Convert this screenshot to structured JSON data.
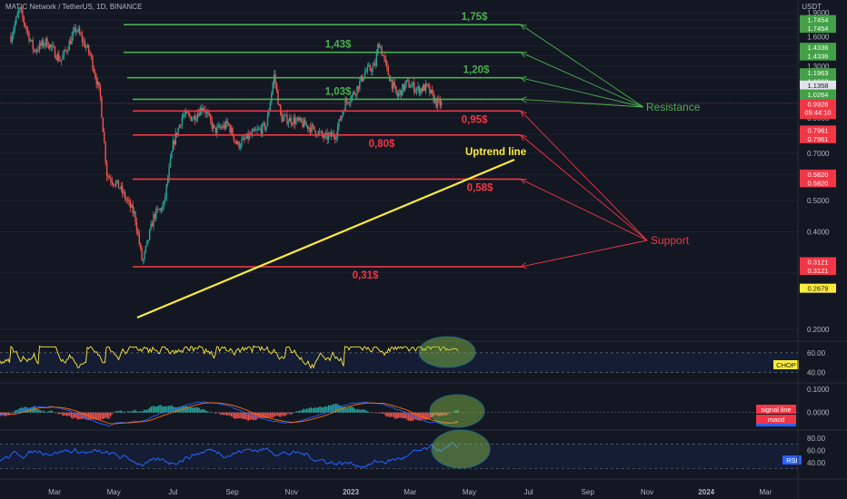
{
  "header": {
    "symbol_line": "MATIC Network / TetherUS, 1D, BINANCE",
    "currency": "USDT"
  },
  "colors": {
    "background": "#131722",
    "candle_up": "#26a69a",
    "candle_down": "#ef5350",
    "resistance": "#4caf50",
    "support": "#f23645",
    "trendline": "#ffeb3b",
    "indicator_yellow": "#ffeb3b",
    "rsi_blue": "#2962ff",
    "highlight_ellipse": "#8bc34a"
  },
  "chart_data": [
    {
      "type": "candlestick",
      "title": "MATIC Network / TetherUS, 1D, BINANCE",
      "y_scale": "log",
      "ylim": [
        0.18,
        2.0
      ],
      "y_ticks": [
        "1.9000",
        "1.8000",
        "1.7000",
        "1.6000",
        "1.5000",
        "1.4000",
        "1.3000",
        "1.2000",
        "1.1000",
        "1.0000",
        "0.9000",
        "0.8000",
        "0.7000",
        "0.6000",
        "0.5000",
        "0.4000",
        "0.3000",
        "0.2000"
      ],
      "x_ticks": [
        "Mar",
        "May",
        "Jul",
        "Sep",
        "Nov",
        "2023",
        "Mar",
        "May",
        "Jul",
        "Sep",
        "Nov",
        "2024",
        "Mar"
      ],
      "price_path": [
        [
          "2022-02-01",
          1.6
        ],
        [
          "2022-02-10",
          1.95
        ],
        [
          "2022-02-25",
          1.45
        ],
        [
          "2022-03-10",
          1.55
        ],
        [
          "2022-03-25",
          1.35
        ],
        [
          "2022-04-10",
          1.7
        ],
        [
          "2022-04-25",
          1.4
        ],
        [
          "2022-05-05",
          1.05
        ],
        [
          "2022-05-12",
          0.6
        ],
        [
          "2022-05-25",
          0.55
        ],
        [
          "2022-06-10",
          0.45
        ],
        [
          "2022-06-18",
          0.32
        ],
        [
          "2022-06-30",
          0.45
        ],
        [
          "2022-07-10",
          0.48
        ],
        [
          "2022-07-20",
          0.75
        ],
        [
          "2022-07-30",
          0.92
        ],
        [
          "2022-08-10",
          0.9
        ],
        [
          "2022-08-20",
          0.98
        ],
        [
          "2022-09-01",
          0.82
        ],
        [
          "2022-09-15",
          0.86
        ],
        [
          "2022-09-25",
          0.74
        ],
        [
          "2022-10-10",
          0.8
        ],
        [
          "2022-10-25",
          0.85
        ],
        [
          "2022-11-02",
          1.22
        ],
        [
          "2022-11-09",
          0.9
        ],
        [
          "2022-11-25",
          0.88
        ],
        [
          "2022-12-10",
          0.84
        ],
        [
          "2022-12-25",
          0.78
        ],
        [
          "2023-01-05",
          0.8
        ],
        [
          "2023-01-15",
          1.0
        ],
        [
          "2023-01-25",
          1.08
        ],
        [
          "2023-02-05",
          1.25
        ],
        [
          "2023-02-15",
          1.3
        ],
        [
          "2023-02-19",
          1.55
        ],
        [
          "2023-02-28",
          1.25
        ],
        [
          "2023-03-10",
          1.05
        ],
        [
          "2023-03-20",
          1.15
        ],
        [
          "2023-04-01",
          1.1
        ],
        [
          "2023-04-10",
          1.12
        ],
        [
          "2023-04-20",
          1.0
        ],
        [
          "2023-04-26",
          0.99
        ]
      ],
      "last_price": "0.9928",
      "countdown": "05:44:10"
    },
    {
      "type": "line",
      "name": "CHOP",
      "ylim": [
        35,
        70
      ],
      "band": [
        40,
        60
      ],
      "y_ticks": [
        "60.00",
        "40.00"
      ],
      "badge": "CHOP"
    },
    {
      "type": "bar",
      "name": "MACD",
      "ylim": [
        -0.06,
        0.12
      ],
      "y_ticks": [
        "0.1000",
        "0.0000"
      ],
      "legend": [
        "signal line",
        "macd"
      ]
    },
    {
      "type": "line",
      "name": "RSI",
      "ylim": [
        25,
        90
      ],
      "band": [
        30,
        70
      ],
      "y_ticks": [
        "80.00",
        "60.00",
        "40.00"
      ],
      "badge": "RSI"
    }
  ],
  "levels": [
    {
      "kind": "resistance",
      "value": 1.7454,
      "label": "1,75$",
      "axis": "1.7454",
      "axis2": "1.7454"
    },
    {
      "kind": "resistance",
      "value": 1.4336,
      "label": "1,43$",
      "axis": "1.4336",
      "axis2": "1.4336"
    },
    {
      "kind": "resistance",
      "value": 1.1963,
      "label": "1,20$",
      "axis": "1.1963",
      "axis2": "1.1963"
    },
    {
      "kind": "resistance",
      "value": 1.0264,
      "label": "1,03$",
      "axis": "1.0264",
      "axis2": "1.0264"
    },
    {
      "kind": "support",
      "value": 0.945,
      "label": "0,95$",
      "axis": "0.9450",
      "axis2": "0.9450"
    },
    {
      "kind": "support",
      "value": 0.7961,
      "label": "0,80$",
      "axis": "0.7961",
      "axis2": "0.7961"
    },
    {
      "kind": "support",
      "value": 0.582,
      "label": "0,58$",
      "axis": "0.5820",
      "axis2": "0.5820"
    },
    {
      "kind": "support",
      "value": 0.3121,
      "label": "0,31$",
      "axis": "0.3121",
      "axis2": "0.3121"
    }
  ],
  "annotations": {
    "resistance_label": "Resistance",
    "support_label": "Support",
    "trendline_label": "Uptrend line",
    "extra_price_tags": [
      {
        "value": 1.1358,
        "text": "1.1358",
        "style": "white"
      },
      {
        "value": 0.2679,
        "text": "0.2679",
        "style": "yellow"
      }
    ]
  }
}
